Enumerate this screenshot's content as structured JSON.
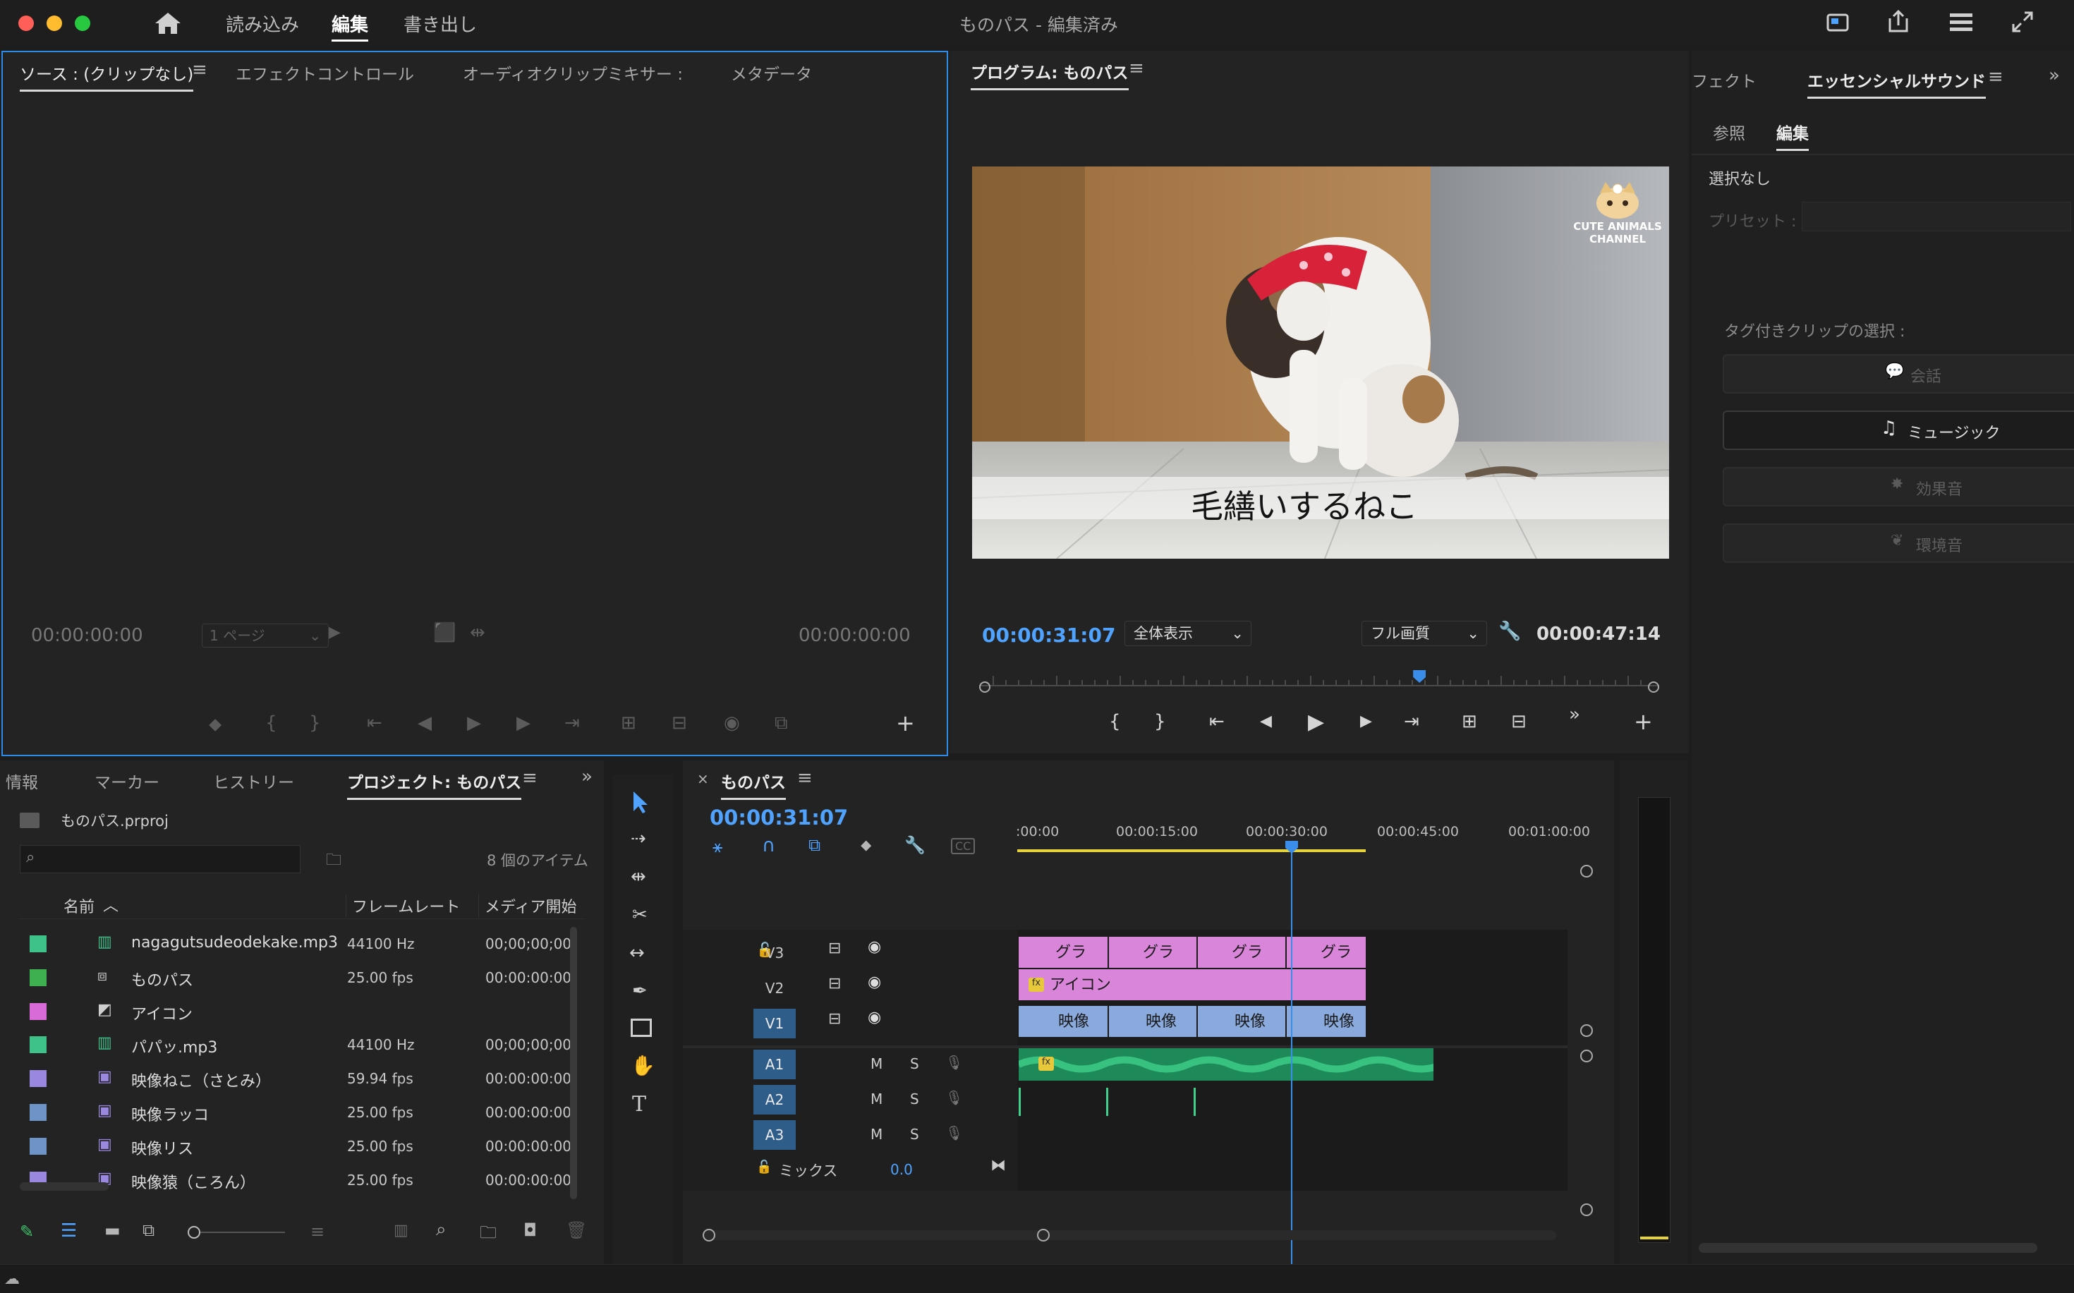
{
  "window": {
    "title": "ものパス - 編集済み",
    "nav": [
      "読み込み",
      "編集",
      "書き出し"
    ],
    "active_nav": "編集"
  },
  "source_panel": {
    "tabs": [
      "ソース : (クリップなし)",
      "エフェクトコントロール",
      "オーディオクリップミキサー :",
      "メタデータ"
    ],
    "timecode_left": "00:00:00:00",
    "timecode_right": "00:00:00:00",
    "page_select": "1 ページ"
  },
  "program_panel": {
    "title": "プログラム: ものパス",
    "overlay_caption": "毛繕いするねこ",
    "logo_text_1": "CUTE ANIMALS",
    "logo_text_2": "CHANNEL",
    "timecode_current": "00:00:31:07",
    "zoom_select": "全体表示",
    "quality_select": "フル画質",
    "timecode_duration": "00:00:47:14",
    "playhead_fraction": 0.65
  },
  "essential_sound": {
    "tabs": [
      "フェクト",
      "エッセンシャルサウンド"
    ],
    "subtabs": [
      "参照",
      "編集"
    ],
    "selection": "選択なし",
    "preset_label": "プリセット :",
    "tag_label": "タグ付きクリップの選択 :",
    "buttons": [
      "会話",
      "ミュージック",
      "効果音",
      "環境音"
    ]
  },
  "project_panel": {
    "tabs": [
      "情報",
      "マーカー",
      "ヒストリー",
      "プロジェクト: ものパス"
    ],
    "file": "ものパス.prproj",
    "item_count": "8 個のアイテム",
    "columns": [
      "名前",
      "フレームレート",
      "メディア開始"
    ],
    "rows": [
      {
        "color": "#3fc28a",
        "icon": "audio-file-icon",
        "name": "nagagutsudeodekake.mp3",
        "rate": "44100 Hz",
        "start": "00;00;00;00"
      },
      {
        "color": "#3fb04f",
        "icon": "sequence-icon",
        "name": "ものパス",
        "rate": "25.00 fps",
        "start": "00:00:00:00"
      },
      {
        "color": "#d86bd8",
        "icon": "graphic-icon",
        "name": "アイコン",
        "rate": "",
        "start": ""
      },
      {
        "color": "#3fc28a",
        "icon": "audio-file-icon",
        "name": "パパッ.mp3",
        "rate": "44100 Hz",
        "start": "00;00;00;00"
      },
      {
        "color": "#9a87e0",
        "icon": "video-file-icon",
        "name": "映像ねこ（さとみ）",
        "rate": "59.94 fps",
        "start": "00:00:00:00"
      },
      {
        "color": "#6d93c7",
        "icon": "video-file-icon",
        "name": "映像ラッコ",
        "rate": "25.00 fps",
        "start": "00:00:00:00"
      },
      {
        "color": "#6d93c7",
        "icon": "video-file-icon",
        "name": "映像リス",
        "rate": "25.00 fps",
        "start": "00:00:00:00"
      },
      {
        "color": "#9a87e0",
        "icon": "video-file-icon",
        "name": "映像猿（ころん）",
        "rate": "25.00 fps",
        "start": "00:00:00:00"
      }
    ]
  },
  "timeline": {
    "sequence_name": "ものパス",
    "timecode": "00:00:31:07",
    "ruler": [
      ":00:00",
      "00:00:15:00",
      "00:00:30:00",
      "00:00:45:00",
      "00:01:00:00"
    ],
    "tracks": {
      "video": [
        "V3",
        "V2",
        "V1"
      ],
      "audio": [
        "A1",
        "A2",
        "A3"
      ],
      "mix_label": "ミックス",
      "mix_value": "0.0",
      "m_label": "M",
      "s_label": "S"
    },
    "v3_clips": [
      "グラ",
      "グラ",
      "グラ",
      "グラ"
    ],
    "v2_clip": "アイコン",
    "v1_clips": [
      "映像",
      "映像",
      "映像",
      "映像"
    ]
  }
}
